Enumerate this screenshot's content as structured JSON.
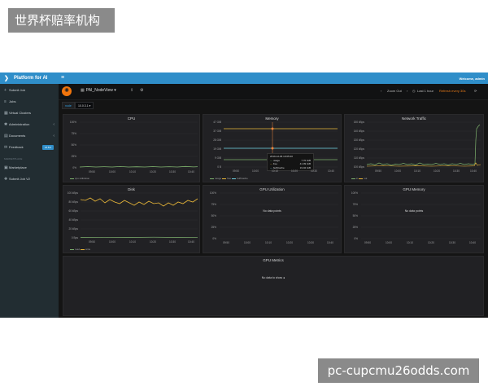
{
  "overlay": {
    "banner": "世界杯赔率机构",
    "watermark": "pc-cupcmu26odds.com"
  },
  "app": {
    "brand": "Platform for AI",
    "user": "Welcome, admin",
    "sidebar": {
      "items": [
        {
          "label": "Submit Job",
          "icon": "plus-icon"
        },
        {
          "label": "Jobs",
          "icon": "list-icon"
        },
        {
          "label": "Virtual Clusters",
          "icon": "cluster-icon"
        },
        {
          "label": "Administration",
          "icon": "gear-icon"
        },
        {
          "label": "Documents",
          "icon": "book-icon"
        },
        {
          "label": "Feedback",
          "icon": "comment-icon",
          "badge": "v0.8.0"
        }
      ],
      "section_header": "MARKETPLACE",
      "bottom_items": [
        {
          "label": "Marketplace",
          "icon": "store-icon"
        },
        {
          "label": "Submit Job V2",
          "icon": "plus-icon"
        }
      ]
    },
    "dashboard": {
      "title": "PAI_NodeView",
      "zoom_out": "Zoom Out",
      "time_range": "Last 1 hour",
      "refresh": "Refresh every 30s",
      "variable_label": "node",
      "variable_value": "10.0.3.1"
    },
    "panels": {
      "cpu": {
        "title": "CPU",
        "yticks": [
          "100%",
          "75%",
          "50%",
          "25%",
          "0%"
        ],
        "xticks": [
          "09:50",
          "10:00",
          "10:10",
          "10:20",
          "10:30",
          "10:40"
        ],
        "legend": [
          "cpu utilization"
        ]
      },
      "memory": {
        "title": "Memory",
        "yticks": [
          "47 GiB",
          "37 GiB",
          "28 GiB",
          "19 GiB",
          "9 GiB",
          "0 B"
        ],
        "xticks": [
          "09:50",
          "10:00",
          "10:10",
          "10:20",
          "10:30",
          "10:40"
        ],
        "legend": [
          "usage",
          "free",
          "buff/cache"
        ],
        "tooltip": {
          "time": "2019-12-06 10:05:20",
          "rows": [
            {
              "name": "usage",
              "value": "7.70 GiB"
            },
            {
              "name": "free",
              "value": "41.09 GiB"
            },
            {
              "name": "buff/cache",
              "value": "19.02 GiB"
            }
          ]
        }
      },
      "network": {
        "title": "Network Traffic",
        "yticks": [
          "150 kBps",
          "140 kBps",
          "130 kBps",
          "120 kBps",
          "110 kBps",
          "100 kBps"
        ],
        "xticks": [
          "09:50",
          "10:00",
          "10:10",
          "10:20",
          "10:30",
          "10:40"
        ],
        "legend": [
          "in",
          "out"
        ]
      },
      "disk": {
        "title": "Disk",
        "yticks": [
          "100 kBps",
          "80 kBps",
          "60 kBps",
          "40 kBps",
          "20 kBps",
          "0 Bps"
        ],
        "xticks": [
          "09:50",
          "10:00",
          "10:10",
          "10:20",
          "10:30",
          "10:40"
        ],
        "legend": [
          "read",
          "write"
        ]
      },
      "gpu_util": {
        "title": "GPU Utilization",
        "yticks": [
          "100%",
          "75%",
          "50%",
          "25%",
          "0%"
        ],
        "xticks": [
          "09:50",
          "10:00",
          "10:10",
          "10:20",
          "10:30",
          "10:40"
        ],
        "empty": "No data points"
      },
      "gpu_mem": {
        "title": "GPU Memory",
        "yticks": [
          "100%",
          "75%",
          "50%",
          "25%",
          "0%"
        ],
        "xticks": [
          "09:50",
          "10:00",
          "10:10",
          "10:20",
          "10:30",
          "10:40"
        ],
        "empty": "No data points"
      },
      "gpu_metrics": {
        "title": "GPU Metrics",
        "empty": "No data to show"
      }
    },
    "colors": {
      "topbar": "#2f8ec9",
      "sidebar": "#222d32",
      "panel": "#212124",
      "green": "#7eb26d",
      "yellow": "#eab839",
      "orange": "#ef843c",
      "cyan": "#6ed0e0"
    }
  }
}
